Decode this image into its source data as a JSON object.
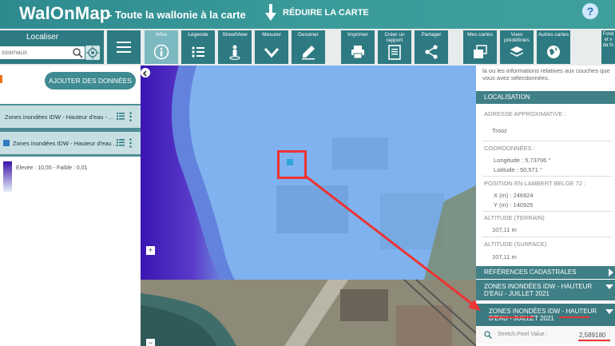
{
  "header": {
    "brand": "WalOnMap",
    "tagline": "- Toute la wallonie à la carte",
    "reduce_label": "RÉDUIRE LA CARTE",
    "help_label": "?"
  },
  "toolbar": {
    "localiser_label": "Localiser",
    "search_value": "ssamaux",
    "tools": [
      {
        "id": "infos",
        "label": "Infos"
      },
      {
        "id": "legende",
        "label": "Légende"
      },
      {
        "id": "streetview",
        "label": "StreetView"
      },
      {
        "id": "mesurer",
        "label": "Mesurer"
      },
      {
        "id": "dessiner",
        "label": "Dessiner"
      },
      {
        "id": "imprimer",
        "label": "Imprimer"
      },
      {
        "id": "rapport",
        "label": "Créer un rapport"
      },
      {
        "id": "partager",
        "label": "Partager"
      },
      {
        "id": "mescartes",
        "label": "Mes cartes"
      },
      {
        "id": "vues",
        "label": "Vues prédéfinies"
      },
      {
        "id": "autres",
        "label": "Autres cartes"
      }
    ],
    "fond_label": "Fond et v da fo"
  },
  "left_panel": {
    "add_data_label": "AJOUTER DES DONNÉES",
    "layers": [
      {
        "name": "Zones inondées IDW - Hauteur d'eau - ..."
      },
      {
        "name": "Zones inondées IDW - Hauteur d'eau ..."
      }
    ],
    "legend_text": "Elevée : 10,55 - Faible : 0,01"
  },
  "right_panel": {
    "intro": "la ou les informations relatives aux couches que vous avez sélectionnées.",
    "localisation_header": "LOCALISATION",
    "address_label": "ADRESSE APPROXIMATIVE :",
    "address_value": "Trooz",
    "coords_label": "COORDONNÉES :",
    "longitude": "Longitude : 5,73706 °",
    "latitude": "Latitude : 50,571 °",
    "lambert_label": "POSITION EN LAMBERT BELGE 72 :",
    "x_value": "X (m) : 246924",
    "y_value": "Y (m) : 140925",
    "alt_terrain_label": "ALTITUDE (TERRAIN)",
    "alt_terrain_value": "107,11 m",
    "alt_surface_label": "ALTITUDE (SURFACE)",
    "alt_surface_value": "107,11 m",
    "cadastre_header": "RÉFÉRENCES CADASTRALES",
    "zones_header_1": "ZONES INONDÉES IDW - HAUTEUR D'EAU - JUILLET 2021",
    "zones_header_2": "ZONES INONDÉES IDW - HAUTEUR D'EAU - JUILLET 2021",
    "stretch_label": "Stretch.Pixel Value :",
    "stretch_value": "2,589180"
  },
  "colors": {
    "brand_teal": "#3a9b9a",
    "tool_teal": "#2e7a82",
    "section_teal": "#3f7f86",
    "highlight_red": "#e33333",
    "flood_blue": "#6ca2e6",
    "flood_deep": "#3b10a8"
  }
}
